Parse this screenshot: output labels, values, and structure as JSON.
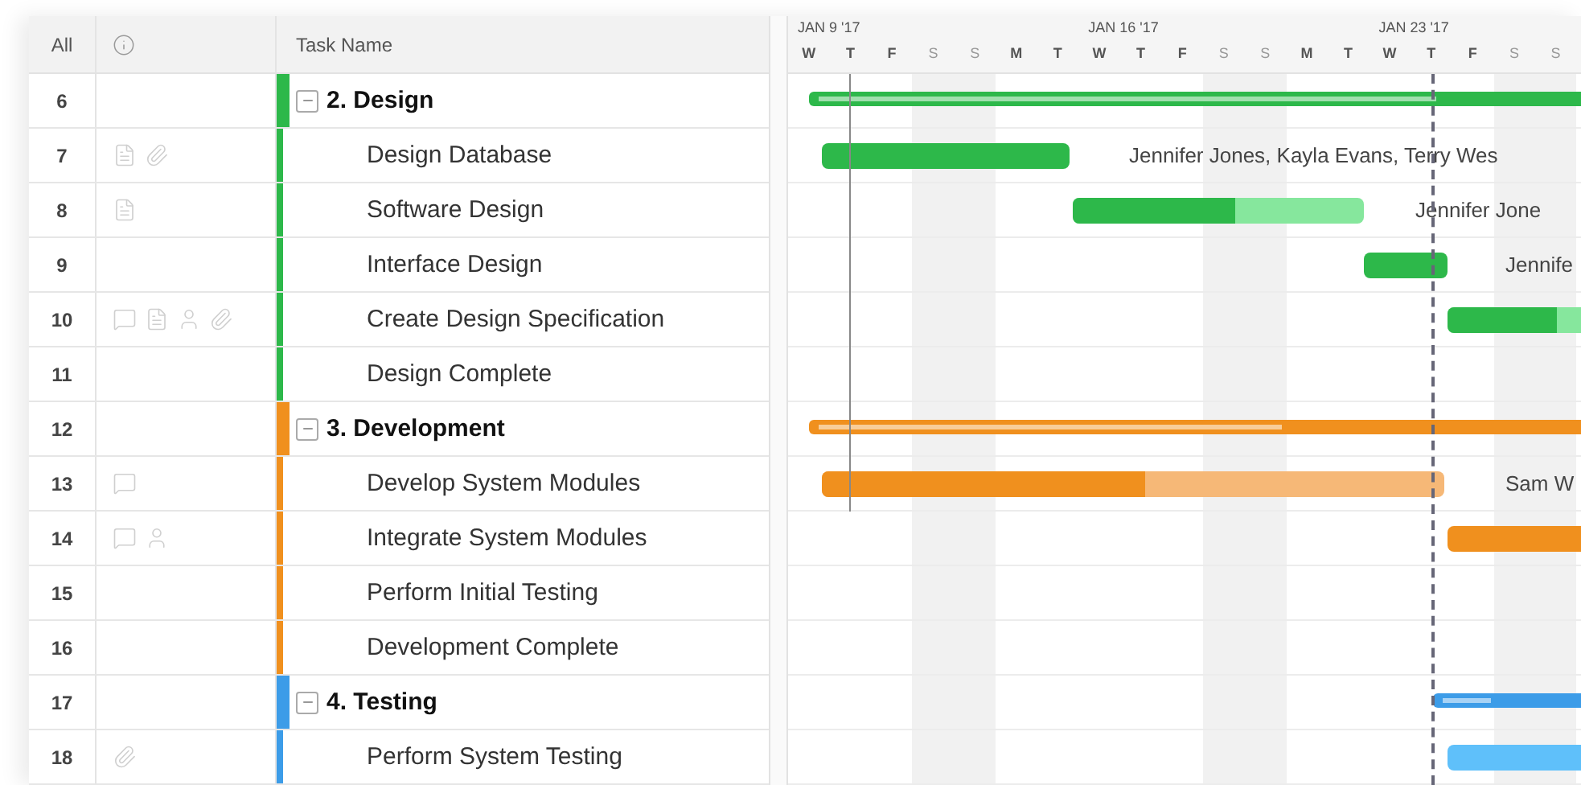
{
  "table": {
    "columns": [
      "All",
      "Task Name"
    ],
    "rows": [
      {
        "number": "6",
        "kind": "section",
        "name": "2. Design",
        "color": "#2db84a",
        "comment": false,
        "note": false,
        "person": false,
        "attachment": false,
        "bar": {
          "level": 0.8
        }
      },
      {
        "number": "7",
        "kind": "task",
        "name": "Design Database",
        "color": "#2db84a",
        "comment": false,
        "note": true,
        "person": false,
        "attachment": true,
        "bar": {
          "level": 1
        },
        "assignees": "Jennifer Jones, Kayla Evans, Terry Wes"
      },
      {
        "number": "8",
        "kind": "task",
        "name": "Software Design",
        "color": "#2db84a",
        "comment": false,
        "note": true,
        "person": false,
        "attachment": false,
        "bar": {
          "level": 0.56
        },
        "assignees": "Jennifer Jone"
      },
      {
        "number": "9",
        "kind": "task",
        "name": "Interface Design",
        "color": "#2db84a",
        "comment": false,
        "note": false,
        "person": false,
        "attachment": false,
        "bar": {
          "level": 1
        },
        "assignees": "Jennife"
      },
      {
        "number": "10",
        "kind": "task",
        "name": "Create Design Specification",
        "color": "#2db84a",
        "comment": true,
        "note": true,
        "person": true,
        "attachment": true,
        "bar": {
          "level": 0.75
        }
      },
      {
        "number": "11",
        "kind": "task",
        "name": "Design Complete",
        "color": "#2db84a",
        "comment": false,
        "note": false,
        "person": false,
        "attachment": false
      },
      {
        "number": "12",
        "kind": "section",
        "name": "3. Development",
        "color": "#f0901e",
        "comment": false,
        "note": false,
        "person": false,
        "attachment": false,
        "bar": {
          "level": 0.6
        }
      },
      {
        "number": "13",
        "kind": "task",
        "name": "Develop System Modules",
        "color": "#f0901e",
        "comment": true,
        "note": false,
        "person": false,
        "attachment": false,
        "bar": {
          "level": 0.52
        },
        "assignees": "Sam W"
      },
      {
        "number": "14",
        "kind": "task",
        "name": "Integrate System Modules",
        "color": "#f0901e",
        "comment": true,
        "note": false,
        "person": true,
        "attachment": false,
        "bar": {
          "level": 1
        }
      },
      {
        "number": "15",
        "kind": "task",
        "name": "Perform Initial Testing",
        "color": "#f0901e",
        "comment": false,
        "note": false,
        "person": false,
        "attachment": false
      },
      {
        "number": "16",
        "kind": "task",
        "name": "Development Complete",
        "color": "#f0901e",
        "comment": false,
        "note": false,
        "person": false,
        "attachment": false
      },
      {
        "number": "17",
        "kind": "section",
        "name": "4. Testing",
        "color": "#3c9ce8",
        "comment": false,
        "note": false,
        "person": false,
        "attachment": false,
        "bar": {
          "level": 0.3
        }
      },
      {
        "number": "18",
        "kind": "task",
        "name": "Perform System Testing",
        "color": "#3c9ce8",
        "comment": false,
        "note": false,
        "person": false,
        "attachment": true,
        "bar": {
          "level": 0
        }
      }
    ]
  },
  "timeline": {
    "weeks": [
      {
        "label": "JAN 9 '17"
      },
      {
        "label": "JAN 16 '17"
      },
      {
        "label": "JAN 23 '17"
      }
    ],
    "days": [
      {
        "label": "W",
        "weekend": false
      },
      {
        "label": "T",
        "weekend": false
      },
      {
        "label": "F",
        "weekend": false
      },
      {
        "label": "S",
        "weekend": true
      },
      {
        "label": "S",
        "weekend": true
      },
      {
        "label": "M",
        "weekend": false
      },
      {
        "label": "T",
        "weekend": false
      },
      {
        "label": "W",
        "weekend": false
      },
      {
        "label": "T",
        "weekend": false
      },
      {
        "label": "F",
        "weekend": false
      },
      {
        "label": "S",
        "weekend": true
      },
      {
        "label": "S",
        "weekend": true
      },
      {
        "label": "M",
        "weekend": false
      },
      {
        "label": "T",
        "weekend": false
      },
      {
        "label": "W",
        "weekend": false
      },
      {
        "label": "T",
        "weekend": false
      },
      {
        "label": "F",
        "weekend": false
      },
      {
        "label": "S",
        "weekend": true
      },
      {
        "label": "S",
        "weekend": true
      }
    ]
  }
}
